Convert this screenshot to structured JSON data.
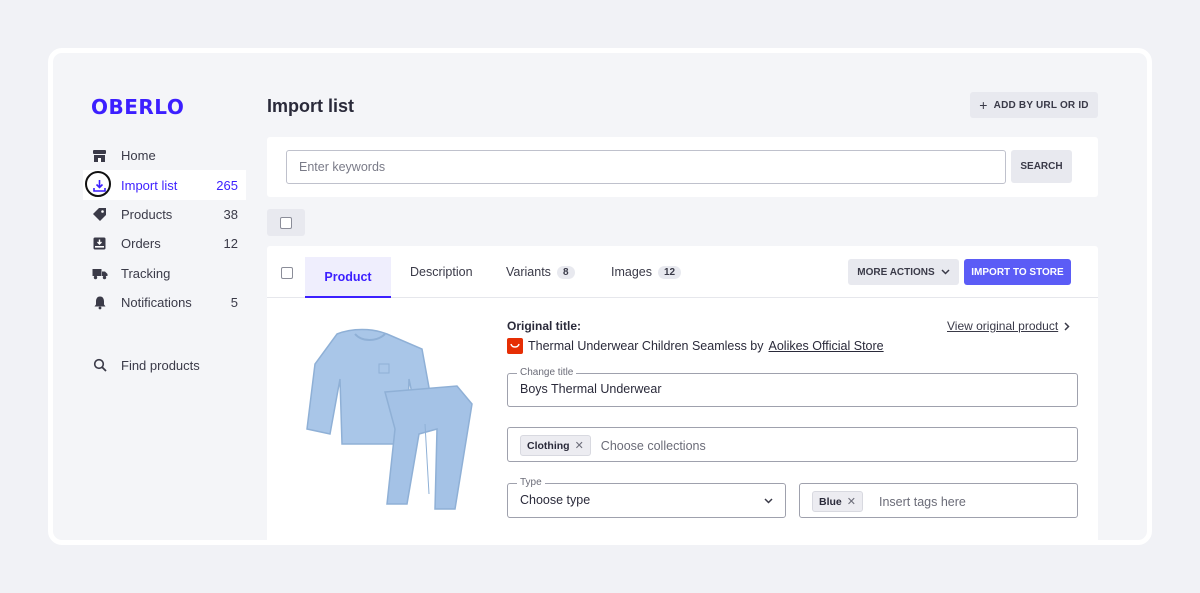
{
  "brand": {
    "logo": "OBERLO",
    "accent": "#3c1fff",
    "button": "#5b5cf6"
  },
  "sidebar": {
    "items": [
      {
        "label": "Home",
        "count": "",
        "icon": "store-icon"
      },
      {
        "label": "Import list",
        "count": "265",
        "icon": "download-icon",
        "active": true
      },
      {
        "label": "Products",
        "count": "38",
        "icon": "tag-icon"
      },
      {
        "label": "Orders",
        "count": "12",
        "icon": "inbox-icon"
      },
      {
        "label": "Tracking",
        "count": "",
        "icon": "truck-icon"
      },
      {
        "label": "Notifications",
        "count": "5",
        "icon": "bell-icon"
      }
    ],
    "find": {
      "label": "Find products",
      "icon": "search-icon"
    }
  },
  "header": {
    "title": "Import list",
    "add_button": "ADD BY URL OR ID"
  },
  "search": {
    "placeholder": "Enter keywords",
    "button": "SEARCH"
  },
  "product": {
    "tabs": [
      {
        "label": "Product",
        "count": ""
      },
      {
        "label": "Description",
        "count": ""
      },
      {
        "label": "Variants",
        "count": "8"
      },
      {
        "label": "Images",
        "count": "12"
      }
    ],
    "more_actions": "MORE ACTIONS",
    "import_button": "IMPORT TO STORE",
    "original_label": "Original title:",
    "original_title": "Thermal Underwear Children Seamless by",
    "store_name": "Aolikes Official Store",
    "view_original": "View original product",
    "change_title_label": "Change title",
    "change_title_value": "Boys Thermal Underwear",
    "collection_chip": "Clothing",
    "collection_placeholder": "Choose collections",
    "type_label": "Type",
    "type_value": "Choose type",
    "tag_chip": "Blue",
    "tags_placeholder": "Insert tags here"
  }
}
